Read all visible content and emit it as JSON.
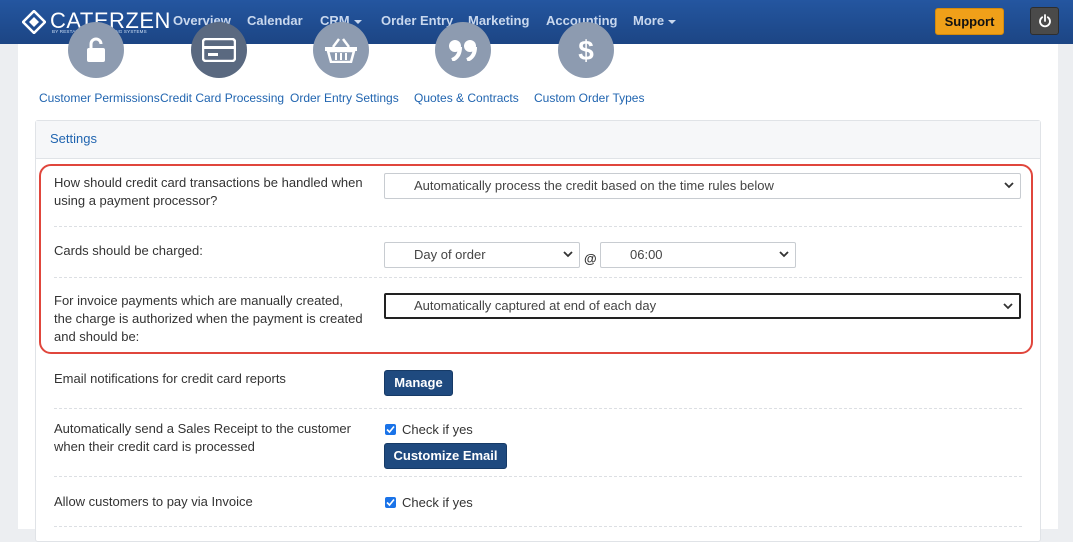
{
  "brand": {
    "name": "CATERZEN",
    "tagline": "BY RESTAURANT & CATERING SYSTEMS"
  },
  "nav": {
    "items": [
      {
        "label": "Overview",
        "dropdown": false
      },
      {
        "label": "Calendar",
        "dropdown": false
      },
      {
        "label": "CRM",
        "dropdown": true
      },
      {
        "label": "Order Entry",
        "dropdown": false
      },
      {
        "label": "Marketing",
        "dropdown": false
      },
      {
        "label": "Accounting",
        "dropdown": false
      },
      {
        "label": "More",
        "dropdown": true
      }
    ],
    "support_label": "Support",
    "power_icon": "power-icon"
  },
  "settings_nav": {
    "tiles": [
      {
        "label": "Customer Permissions",
        "icon": "lock-icon",
        "active": false
      },
      {
        "label": "Credit Card Processing",
        "icon": "credit-card-icon",
        "active": true
      },
      {
        "label": "Order Entry Settings",
        "icon": "basket-icon",
        "active": false
      },
      {
        "label": "Quotes & Contracts",
        "icon": "quote-icon",
        "active": false
      },
      {
        "label": "Custom Order Types",
        "icon": "dollar-icon",
        "active": false
      }
    ]
  },
  "settings": {
    "heading": "Settings",
    "processing_question": "How should credit card transactions be handled when using a payment processor?",
    "processing_value": "Automatically process the credit based on the time rules below",
    "charge_label": "Cards should be charged:",
    "charge_day_value": "Day of order",
    "at_symbol": "@",
    "charge_time_value": "06:00",
    "invoice_question": "For invoice payments which are manually created, the charge is authorized when the payment is created and should be:",
    "invoice_value": "Automatically captured at end of each day",
    "email_notif_label": "Email notifications for credit card reports",
    "manage_button": "Manage",
    "sales_receipt_label": "Automatically send a Sales Receipt to the customer when their credit card is processed",
    "sales_receipt_checked": true,
    "check_if_yes": "Check if yes",
    "customize_email_button": "Customize Email",
    "pay_invoice_label": "Allow customers to pay via Invoice",
    "pay_invoice_checked": true
  },
  "colors": {
    "nav_bg": "#1f4a8a",
    "support": "#f0a019",
    "highlight": "#e0463c",
    "primary_button": "#1f4a7f",
    "link": "#2165b0"
  }
}
